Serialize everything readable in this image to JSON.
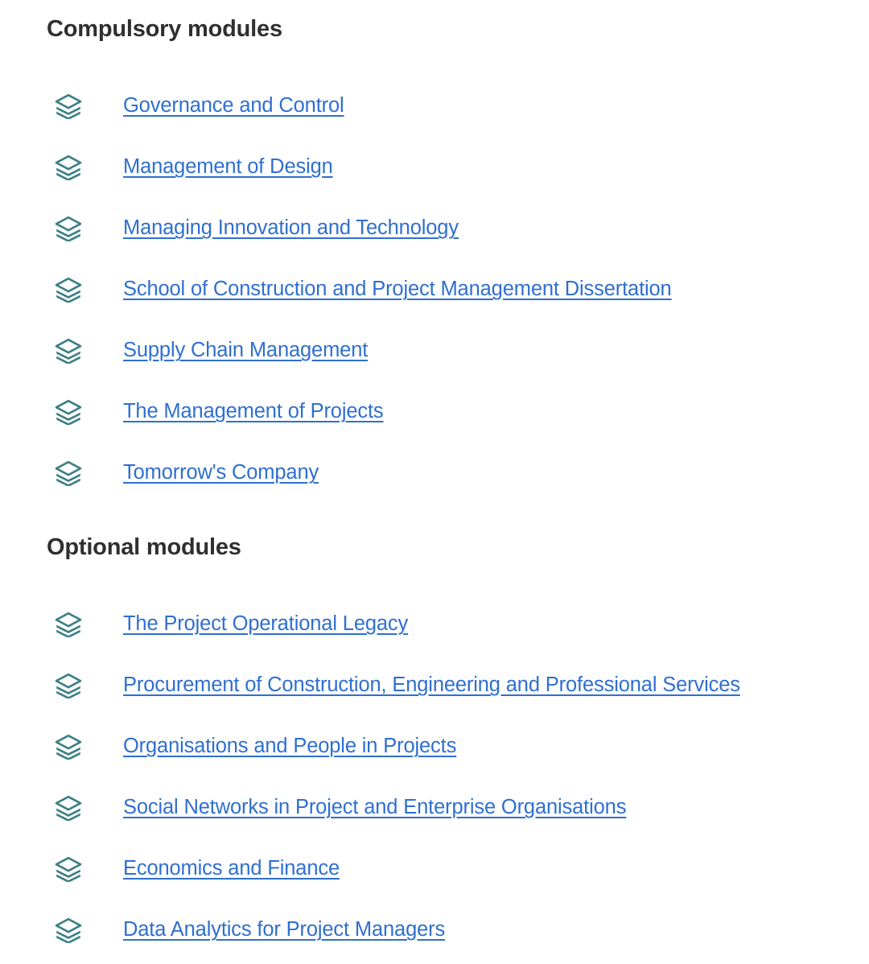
{
  "page": {
    "background_color": "#ffffff",
    "heading_color": "#2f2f2f",
    "link_color": "#2f6fd0",
    "icon_color": "#3d8085"
  },
  "sections": [
    {
      "id": "compulsory",
      "heading": "Compulsory modules",
      "icon_name": "layers-icon",
      "modules": [
        {
          "label": "Governance and Control"
        },
        {
          "label": "Management of Design"
        },
        {
          "label": "Managing Innovation and Technology"
        },
        {
          "label": "School of Construction and Project Management Dissertation"
        },
        {
          "label": "Supply Chain Management"
        },
        {
          "label": "The Management of Projects"
        },
        {
          "label": "Tomorrow's Company"
        }
      ]
    },
    {
      "id": "optional",
      "heading": "Optional modules",
      "icon_name": "layers-icon",
      "modules": [
        {
          "label": "The Project Operational Legacy"
        },
        {
          "label": "Procurement of Construction, Engineering and Professional Services"
        },
        {
          "label": "Organisations and People in Projects"
        },
        {
          "label": "Social Networks in Project and Enterprise Organisations"
        },
        {
          "label": "Economics and Finance"
        },
        {
          "label": "Data Analytics for Project Managers"
        }
      ]
    }
  ]
}
